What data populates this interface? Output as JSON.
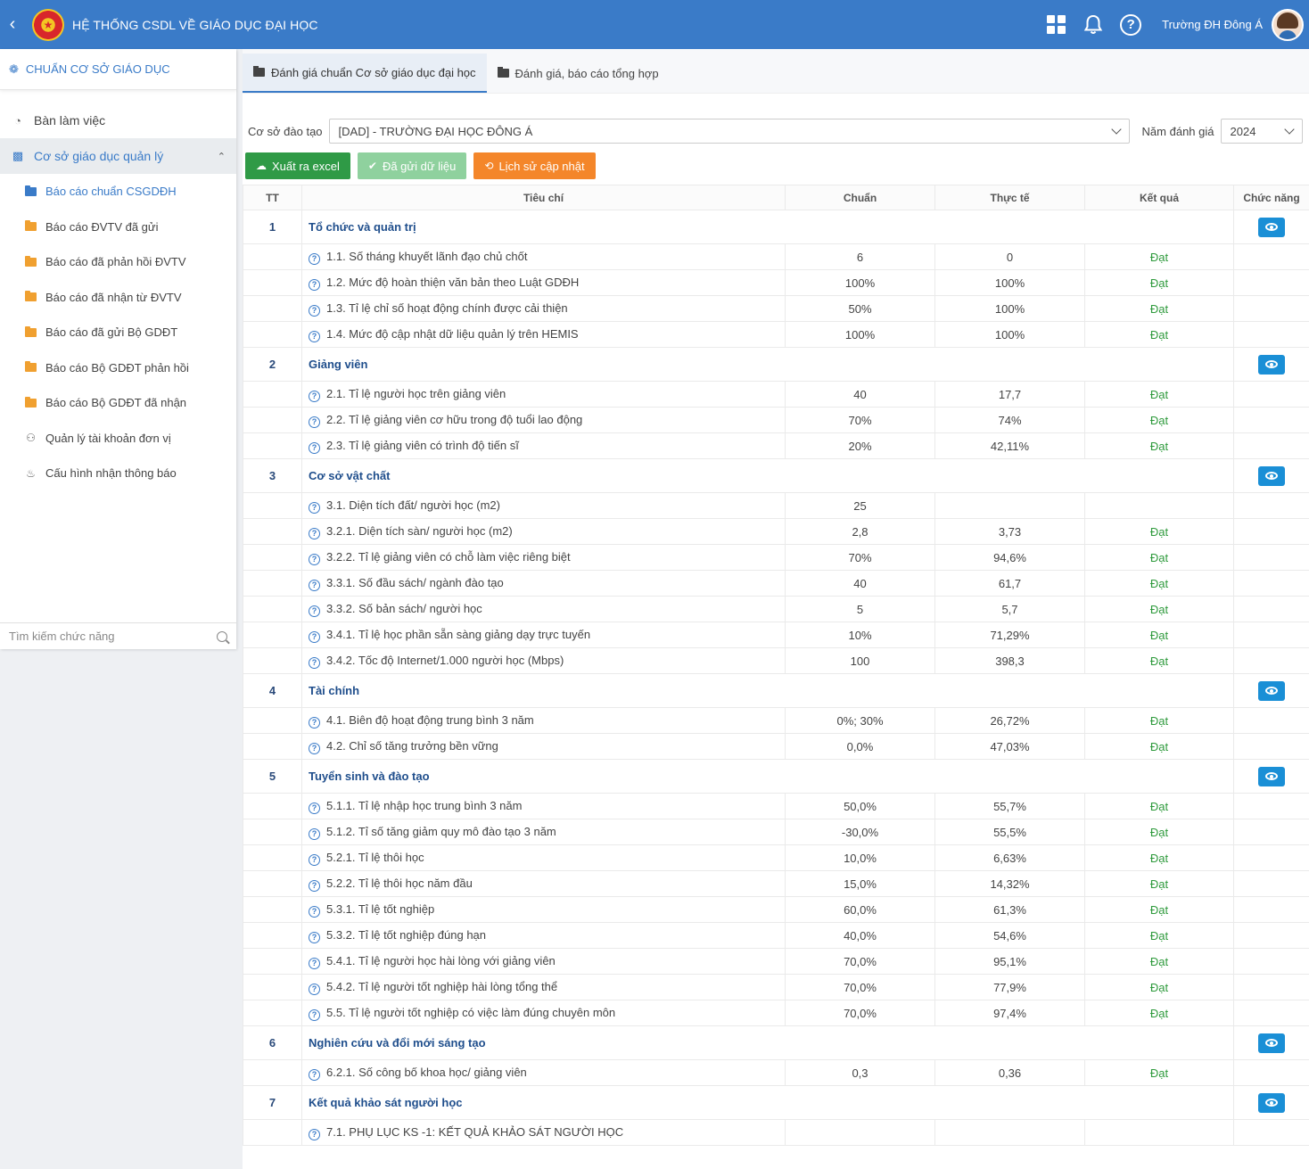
{
  "header": {
    "title": "HỆ THỐNG CSDL VỀ GIÁO DỤC ĐẠI HỌC",
    "user_name": "Trường ĐH Đông Á",
    "icons": [
      "back-arrow-icon",
      "national-emblem-logo",
      "apps-grid-icon",
      "bell-icon",
      "help-icon",
      "avatar"
    ]
  },
  "sidebar": {
    "section_title": "CHUẨN CƠ SỞ GIÁO DỤC",
    "items": [
      {
        "label": "Bàn làm việc",
        "icon": "dashboard-icon"
      },
      {
        "label": "Cơ sở giáo dục quản lý",
        "icon": "institution-icon",
        "active": true,
        "expanded": true
      }
    ],
    "sub_items": [
      {
        "label": "Báo cáo chuẩn CSGDĐH",
        "icon": "folder-icon",
        "active": true
      },
      {
        "label": "Báo cáo ĐVTV đã gửi",
        "icon": "folder-icon"
      },
      {
        "label": "Báo cáo đã phản hồi ĐVTV",
        "icon": "folder-icon"
      },
      {
        "label": "Báo cáo đã nhận từ ĐVTV",
        "icon": "folder-icon"
      },
      {
        "label": "Báo cáo đã gửi Bộ GDĐT",
        "icon": "folder-icon"
      },
      {
        "label": "Báo cáo Bộ GDĐT phản hồi",
        "icon": "folder-icon"
      },
      {
        "label": "Báo cáo Bộ GDĐT đã nhận",
        "icon": "folder-icon"
      },
      {
        "label": "Quản lý tài khoản đơn vị",
        "icon": "user-icon"
      },
      {
        "label": "Cấu hình nhận thông báo",
        "icon": "bell-icon"
      }
    ],
    "search_placeholder": "Tìm kiếm chức năng"
  },
  "tabs": [
    {
      "label": "Đánh giá chuẩn Cơ sở giáo dục đại học",
      "active": true
    },
    {
      "label": "Đánh giá, báo cáo tổng hợp",
      "active": false
    }
  ],
  "filters": {
    "institution_label": "Cơ sở đào tạo",
    "institution_value": "[DAD] - TRƯỜNG ĐẠI HỌC ĐÔNG Á",
    "year_label": "Năm đánh giá",
    "year_value": "2024"
  },
  "actions": {
    "export": "Xuất ra excel",
    "sent": "Đã gửi dữ liệu",
    "history": "Lịch sử cập nhật"
  },
  "colors": {
    "primary": "#3a7bc8",
    "export": "#2f9a46",
    "sent": "#8fd19e",
    "history": "#f4862a",
    "pass": "#2e9a3c",
    "view": "#1a8fd6"
  },
  "table": {
    "headers": [
      "TT",
      "Tiêu chí",
      "Chuẩn",
      "Thực tế",
      "Kết quả",
      "Chức năng"
    ],
    "groups": [
      {
        "tt": "1",
        "name": "Tổ chức và quản trị",
        "items": [
          {
            "name": "1.1. Số tháng khuyết lãnh đạo chủ chốt",
            "chuan": "6",
            "thucte": "0",
            "ketqua": "Đạt"
          },
          {
            "name": "1.2. Mức độ hoàn thiện văn bản theo Luật GDĐH",
            "chuan": "100%",
            "thucte": "100%",
            "ketqua": "Đạt"
          },
          {
            "name": "1.3. Tỉ lệ chỉ số hoạt động chính được cải thiện",
            "chuan": "50%",
            "thucte": "100%",
            "ketqua": "Đạt"
          },
          {
            "name": "1.4. Mức độ cập nhật dữ liệu quản lý trên HEMIS",
            "chuan": "100%",
            "thucte": "100%",
            "ketqua": "Đạt"
          }
        ]
      },
      {
        "tt": "2",
        "name": "Giảng viên",
        "items": [
          {
            "name": "2.1. Tỉ lệ người học trên giảng viên",
            "chuan": "40",
            "thucte": "17,7",
            "ketqua": "Đạt"
          },
          {
            "name": "2.2. Tỉ lệ giảng viên cơ hữu trong độ tuổi lao động",
            "chuan": "70%",
            "thucte": "74%",
            "ketqua": "Đạt"
          },
          {
            "name": "2.3. Tỉ lệ giảng viên có trình độ tiến sĩ",
            "chuan": "20%",
            "thucte": "42,11%",
            "ketqua": "Đạt"
          }
        ]
      },
      {
        "tt": "3",
        "name": "Cơ sở vật chất",
        "items": [
          {
            "name": "3.1. Diện tích đất/ người học (m2)",
            "chuan": "25",
            "thucte": "",
            "ketqua": ""
          },
          {
            "name": "3.2.1. Diện tích sàn/ người học (m2)",
            "chuan": "2,8",
            "thucte": "3,73",
            "ketqua": "Đạt"
          },
          {
            "name": "3.2.2. Tỉ lệ giảng viên có chỗ làm việc riêng biệt",
            "chuan": "70%",
            "thucte": "94,6%",
            "ketqua": "Đạt"
          },
          {
            "name": "3.3.1. Số đầu sách/ ngành đào tạo",
            "chuan": "40",
            "thucte": "61,7",
            "ketqua": "Đạt"
          },
          {
            "name": "3.3.2. Số bản sách/ người học",
            "chuan": "5",
            "thucte": "5,7",
            "ketqua": "Đạt"
          },
          {
            "name": "3.4.1. Tỉ lệ học phần sẵn sàng giảng dạy trực tuyến",
            "chuan": "10%",
            "thucte": "71,29%",
            "ketqua": "Đạt"
          },
          {
            "name": "3.4.2. Tốc độ Internet/1.000 người học (Mbps)",
            "chuan": "100",
            "thucte": "398,3",
            "ketqua": "Đạt"
          }
        ]
      },
      {
        "tt": "4",
        "name": "Tài chính",
        "items": [
          {
            "name": "4.1. Biên độ hoạt động trung bình 3 năm",
            "chuan": "0%; 30%",
            "thucte": "26,72%",
            "ketqua": "Đạt"
          },
          {
            "name": "4.2. Chỉ số tăng trưởng bền vững",
            "chuan": "0,0%",
            "thucte": "47,03%",
            "ketqua": "Đạt"
          }
        ]
      },
      {
        "tt": "5",
        "name": "Tuyển sinh và đào tạo",
        "items": [
          {
            "name": "5.1.1. Tỉ lệ nhập học trung bình 3 năm",
            "chuan": "50,0%",
            "thucte": "55,7%",
            "ketqua": "Đạt"
          },
          {
            "name": "5.1.2. Tỉ số tăng giảm quy mô đào tạo 3 năm",
            "chuan": "-30,0%",
            "thucte": "55,5%",
            "ketqua": "Đạt"
          },
          {
            "name": "5.2.1. Tỉ lệ thôi học",
            "chuan": "10,0%",
            "thucte": "6,63%",
            "ketqua": "Đạt"
          },
          {
            "name": "5.2.2. Tỉ lệ thôi học năm đầu",
            "chuan": "15,0%",
            "thucte": "14,32%",
            "ketqua": "Đạt"
          },
          {
            "name": "5.3.1. Tỉ lệ tốt nghiệp",
            "chuan": "60,0%",
            "thucte": "61,3%",
            "ketqua": "Đạt"
          },
          {
            "name": "5.3.2. Tỉ lệ tốt nghiệp đúng hạn",
            "chuan": "40,0%",
            "thucte": "54,6%",
            "ketqua": "Đạt"
          },
          {
            "name": "5.4.1. Tỉ lệ người học hài lòng với giảng viên",
            "chuan": "70,0%",
            "thucte": "95,1%",
            "ketqua": "Đạt"
          },
          {
            "name": "5.4.2. Tỉ lệ người tốt nghiệp hài lòng tổng thể",
            "chuan": "70,0%",
            "thucte": "77,9%",
            "ketqua": "Đạt"
          },
          {
            "name": "5.5. Tỉ lệ người tốt nghiệp có việc làm đúng chuyên môn",
            "chuan": "70,0%",
            "thucte": "97,4%",
            "ketqua": "Đạt"
          }
        ]
      },
      {
        "tt": "6",
        "name": "Nghiên cứu và đổi mới sáng tạo",
        "items": [
          {
            "name": "6.2.1. Số công bố khoa học/ giảng viên",
            "chuan": "0,3",
            "thucte": "0,36",
            "ketqua": "Đạt"
          }
        ]
      },
      {
        "tt": "7",
        "name": "Kết quả khảo sát người học",
        "items": [
          {
            "name": "7.1. PHỤ LỤC KS -1: KẾT QUẢ KHẢO SÁT NGƯỜI HỌC",
            "chuan": "",
            "thucte": "",
            "ketqua": ""
          }
        ]
      }
    ]
  }
}
